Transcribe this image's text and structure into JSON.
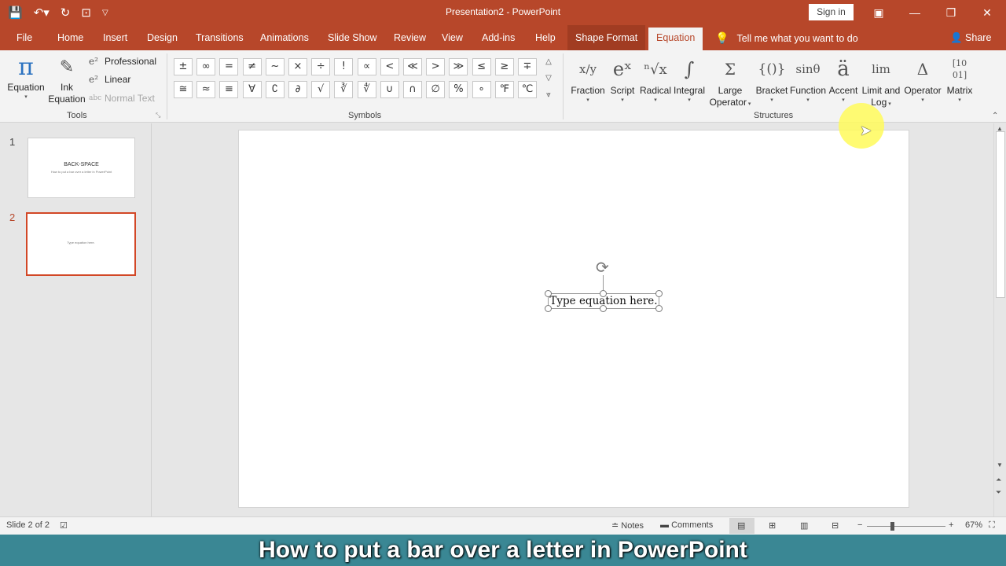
{
  "title_bar": {
    "document_title": "Presentation2  -  PowerPoint",
    "signin_label": "Sign in",
    "qat_icons": [
      "save-icon",
      "undo-icon",
      "redo-icon",
      "present-icon",
      "customize-icon"
    ]
  },
  "tabs": [
    "File",
    "Home",
    "Insert",
    "Design",
    "Transitions",
    "Animations",
    "Slide Show",
    "Review",
    "View",
    "Add-ins",
    "Help",
    "Shape Format",
    "Equation"
  ],
  "tell_me": "Tell me what you want to do",
  "share_label": "Share",
  "ribbon": {
    "tools": {
      "label": "Tools",
      "equation": "Equation",
      "ink_line1": "Ink",
      "ink_line2": "Equation",
      "professional": "Professional",
      "linear": "Linear",
      "normal_text": "Normal Text"
    },
    "symbols": {
      "label": "Symbols",
      "row1": [
        "±",
        "∞",
        "=",
        "≠",
        "~",
        "×",
        "÷",
        "!",
        "∝",
        "<",
        "≪",
        ">",
        "≫",
        "≤",
        "≥",
        "∓"
      ],
      "row2": [
        "≅",
        "≈",
        "≡",
        "∀",
        "∁",
        "∂",
        "√",
        "∛",
        "∜",
        "∪",
        "∩",
        "∅",
        "%",
        "∘",
        "℉",
        "℃"
      ]
    },
    "structures": {
      "label": "Structures",
      "items": [
        {
          "glyph": "x/y",
          "label": "Fraction"
        },
        {
          "glyph": "eˣ",
          "label": "Script"
        },
        {
          "glyph": "ⁿ√x",
          "label": "Radical"
        },
        {
          "glyph": "∫",
          "label": "Integral"
        },
        {
          "glyph": "Σ",
          "label": "Large",
          "label2": "Operator"
        },
        {
          "glyph": "{()}",
          "label": "Bracket"
        },
        {
          "glyph": "sinθ",
          "label": "Function"
        },
        {
          "glyph": "ä",
          "label": "Accent"
        },
        {
          "glyph": "lim",
          "label": "Limit and",
          "label2": "Log"
        },
        {
          "glyph": "Δ",
          "label": "Operator"
        },
        {
          "glyph": "[10 01]",
          "label": "Matrix"
        }
      ]
    }
  },
  "slides": [
    {
      "number": "1",
      "title": "BACK-SPACE",
      "subtitle": "How to put a bar over a letter in PowerPoint"
    },
    {
      "number": "2",
      "title": "",
      "subtitle": "Type equation here."
    }
  ],
  "editor": {
    "equation_placeholder": "Type equation here."
  },
  "status_bar": {
    "slide_info": "Slide 2 of 2",
    "notes": "Notes",
    "comments": "Comments",
    "zoom": "67%"
  },
  "banner": "How to put a bar over a letter in PowerPoint"
}
